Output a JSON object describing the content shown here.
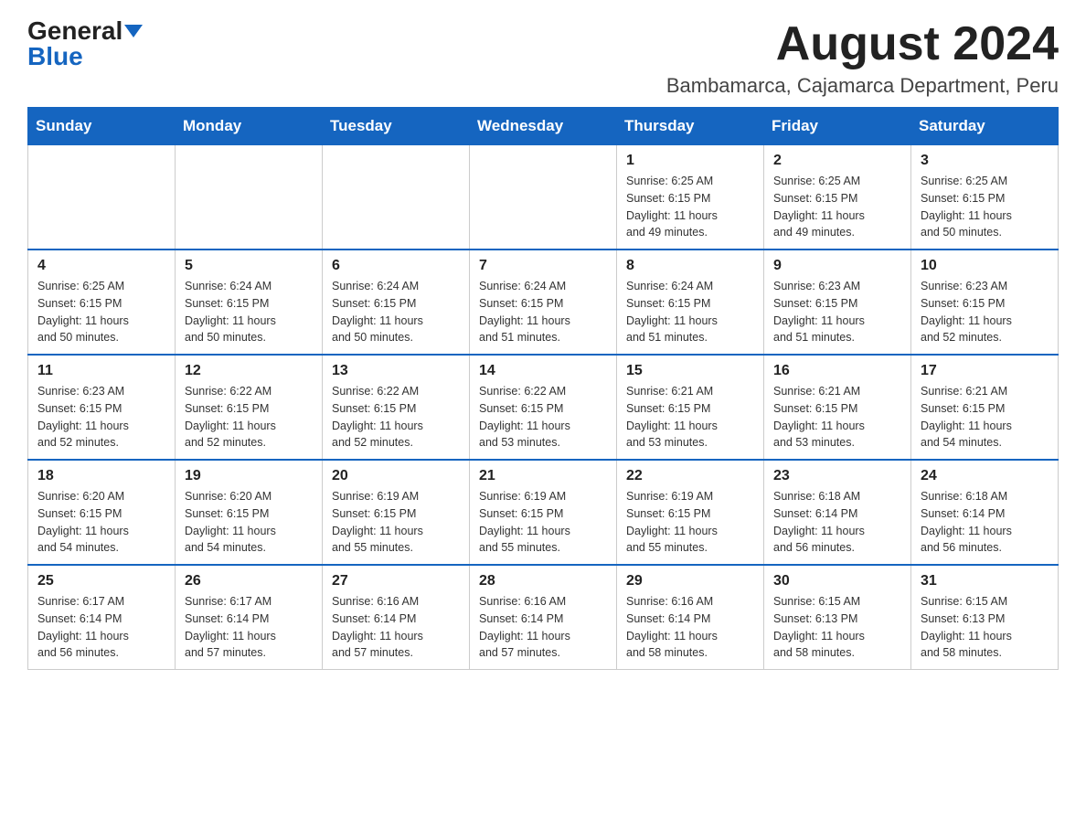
{
  "header": {
    "logo_general": "General",
    "logo_blue": "Blue",
    "month_year": "August 2024",
    "location": "Bambamarca, Cajamarca Department, Peru"
  },
  "days_of_week": [
    "Sunday",
    "Monday",
    "Tuesday",
    "Wednesday",
    "Thursday",
    "Friday",
    "Saturday"
  ],
  "weeks": [
    [
      {
        "day": "",
        "info": ""
      },
      {
        "day": "",
        "info": ""
      },
      {
        "day": "",
        "info": ""
      },
      {
        "day": "",
        "info": ""
      },
      {
        "day": "1",
        "info": "Sunrise: 6:25 AM\nSunset: 6:15 PM\nDaylight: 11 hours\nand 49 minutes."
      },
      {
        "day": "2",
        "info": "Sunrise: 6:25 AM\nSunset: 6:15 PM\nDaylight: 11 hours\nand 49 minutes."
      },
      {
        "day": "3",
        "info": "Sunrise: 6:25 AM\nSunset: 6:15 PM\nDaylight: 11 hours\nand 50 minutes."
      }
    ],
    [
      {
        "day": "4",
        "info": "Sunrise: 6:25 AM\nSunset: 6:15 PM\nDaylight: 11 hours\nand 50 minutes."
      },
      {
        "day": "5",
        "info": "Sunrise: 6:24 AM\nSunset: 6:15 PM\nDaylight: 11 hours\nand 50 minutes."
      },
      {
        "day": "6",
        "info": "Sunrise: 6:24 AM\nSunset: 6:15 PM\nDaylight: 11 hours\nand 50 minutes."
      },
      {
        "day": "7",
        "info": "Sunrise: 6:24 AM\nSunset: 6:15 PM\nDaylight: 11 hours\nand 51 minutes."
      },
      {
        "day": "8",
        "info": "Sunrise: 6:24 AM\nSunset: 6:15 PM\nDaylight: 11 hours\nand 51 minutes."
      },
      {
        "day": "9",
        "info": "Sunrise: 6:23 AM\nSunset: 6:15 PM\nDaylight: 11 hours\nand 51 minutes."
      },
      {
        "day": "10",
        "info": "Sunrise: 6:23 AM\nSunset: 6:15 PM\nDaylight: 11 hours\nand 52 minutes."
      }
    ],
    [
      {
        "day": "11",
        "info": "Sunrise: 6:23 AM\nSunset: 6:15 PM\nDaylight: 11 hours\nand 52 minutes."
      },
      {
        "day": "12",
        "info": "Sunrise: 6:22 AM\nSunset: 6:15 PM\nDaylight: 11 hours\nand 52 minutes."
      },
      {
        "day": "13",
        "info": "Sunrise: 6:22 AM\nSunset: 6:15 PM\nDaylight: 11 hours\nand 52 minutes."
      },
      {
        "day": "14",
        "info": "Sunrise: 6:22 AM\nSunset: 6:15 PM\nDaylight: 11 hours\nand 53 minutes."
      },
      {
        "day": "15",
        "info": "Sunrise: 6:21 AM\nSunset: 6:15 PM\nDaylight: 11 hours\nand 53 minutes."
      },
      {
        "day": "16",
        "info": "Sunrise: 6:21 AM\nSunset: 6:15 PM\nDaylight: 11 hours\nand 53 minutes."
      },
      {
        "day": "17",
        "info": "Sunrise: 6:21 AM\nSunset: 6:15 PM\nDaylight: 11 hours\nand 54 minutes."
      }
    ],
    [
      {
        "day": "18",
        "info": "Sunrise: 6:20 AM\nSunset: 6:15 PM\nDaylight: 11 hours\nand 54 minutes."
      },
      {
        "day": "19",
        "info": "Sunrise: 6:20 AM\nSunset: 6:15 PM\nDaylight: 11 hours\nand 54 minutes."
      },
      {
        "day": "20",
        "info": "Sunrise: 6:19 AM\nSunset: 6:15 PM\nDaylight: 11 hours\nand 55 minutes."
      },
      {
        "day": "21",
        "info": "Sunrise: 6:19 AM\nSunset: 6:15 PM\nDaylight: 11 hours\nand 55 minutes."
      },
      {
        "day": "22",
        "info": "Sunrise: 6:19 AM\nSunset: 6:15 PM\nDaylight: 11 hours\nand 55 minutes."
      },
      {
        "day": "23",
        "info": "Sunrise: 6:18 AM\nSunset: 6:14 PM\nDaylight: 11 hours\nand 56 minutes."
      },
      {
        "day": "24",
        "info": "Sunrise: 6:18 AM\nSunset: 6:14 PM\nDaylight: 11 hours\nand 56 minutes."
      }
    ],
    [
      {
        "day": "25",
        "info": "Sunrise: 6:17 AM\nSunset: 6:14 PM\nDaylight: 11 hours\nand 56 minutes."
      },
      {
        "day": "26",
        "info": "Sunrise: 6:17 AM\nSunset: 6:14 PM\nDaylight: 11 hours\nand 57 minutes."
      },
      {
        "day": "27",
        "info": "Sunrise: 6:16 AM\nSunset: 6:14 PM\nDaylight: 11 hours\nand 57 minutes."
      },
      {
        "day": "28",
        "info": "Sunrise: 6:16 AM\nSunset: 6:14 PM\nDaylight: 11 hours\nand 57 minutes."
      },
      {
        "day": "29",
        "info": "Sunrise: 6:16 AM\nSunset: 6:14 PM\nDaylight: 11 hours\nand 58 minutes."
      },
      {
        "day": "30",
        "info": "Sunrise: 6:15 AM\nSunset: 6:13 PM\nDaylight: 11 hours\nand 58 minutes."
      },
      {
        "day": "31",
        "info": "Sunrise: 6:15 AM\nSunset: 6:13 PM\nDaylight: 11 hours\nand 58 minutes."
      }
    ]
  ]
}
